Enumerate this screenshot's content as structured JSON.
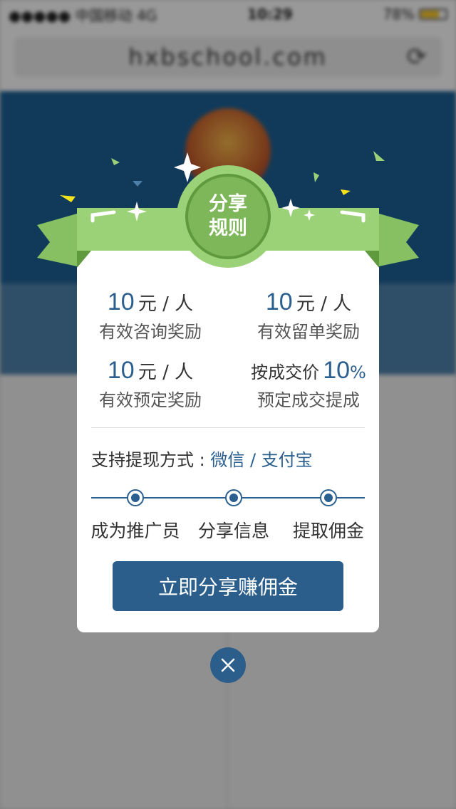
{
  "status_bar": {
    "carrier": "●●●●● 中国移动  4G",
    "time": "10:29",
    "battery": "78%"
  },
  "browser": {
    "url": "hxbschool.com",
    "refresh_icon": "refresh-icon"
  },
  "modal": {
    "badge_line1": "分享",
    "badge_line2": "规则",
    "rewards": [
      {
        "amount": "10",
        "unit": "元 / 人",
        "desc": "有效咨询奖励"
      },
      {
        "amount": "10",
        "unit": "元 / 人",
        "desc": "有效留单奖励"
      },
      {
        "amount": "10",
        "unit": "元 / 人",
        "desc": "有效预定奖励"
      },
      {
        "prefix": "按成交价",
        "amount": "10",
        "unit": "%",
        "desc": "预定成交提成"
      }
    ],
    "withdraw_label": "支持提现方式 : ",
    "withdraw_methods": "微信 / 支付宝",
    "steps": [
      "成为推广员",
      "分享信息",
      "提取佣金"
    ],
    "cta_label": "立即分享赚佣金",
    "close_icon": "close-icon"
  },
  "colors": {
    "accent_blue": "#2c5e8b",
    "ribbon_green": "#9bd277",
    "badge_green": "#7eb65a"
  }
}
